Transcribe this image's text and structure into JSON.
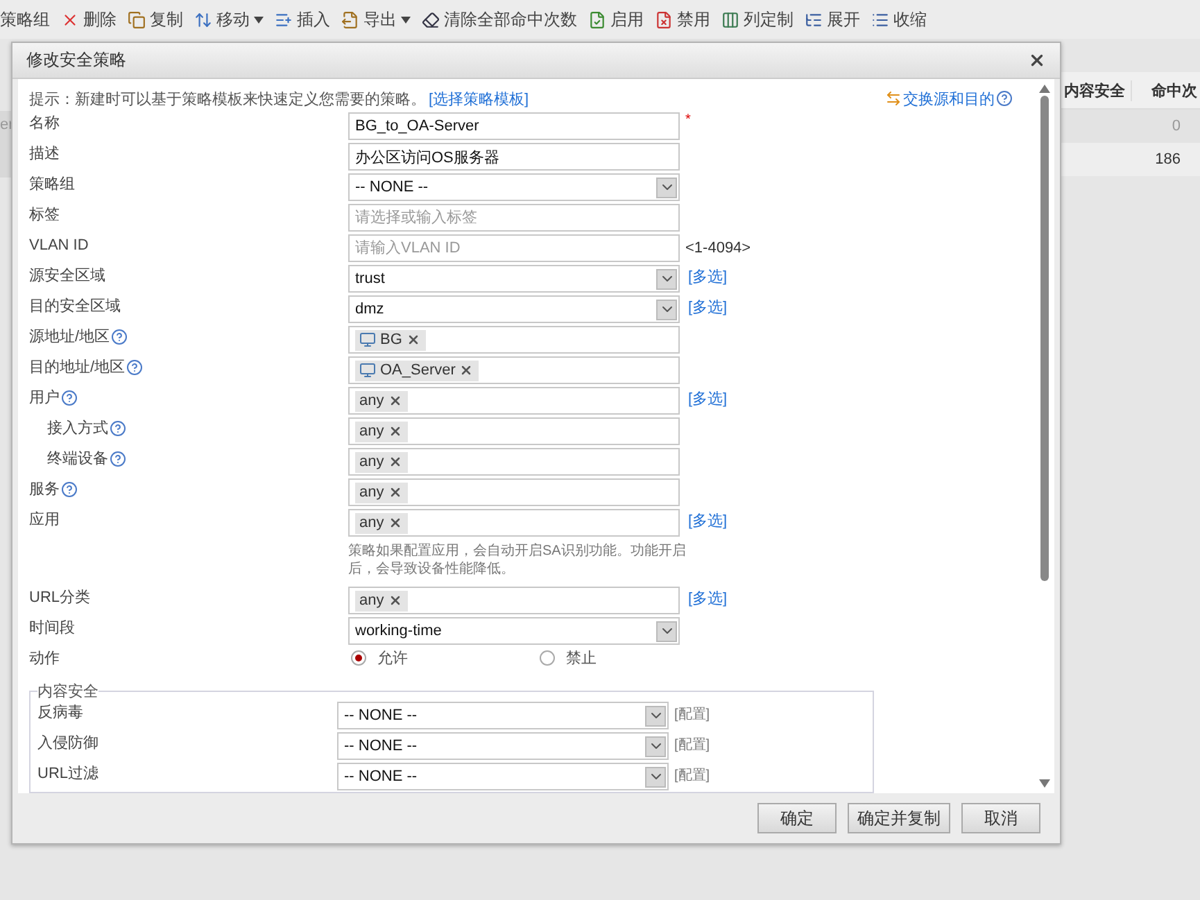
{
  "toolbar": [
    {
      "label": "策略组",
      "kind": "plain",
      "dropdown": false
    },
    {
      "label": "删除",
      "kind": "delete",
      "dropdown": false
    },
    {
      "label": "复制",
      "kind": "copy",
      "dropdown": false
    },
    {
      "label": "移动",
      "kind": "move",
      "dropdown": true
    },
    {
      "label": "插入",
      "kind": "insert",
      "dropdown": false
    },
    {
      "label": "导出",
      "kind": "export",
      "dropdown": true
    },
    {
      "label": "清除全部命中次数",
      "kind": "clear",
      "dropdown": false
    },
    {
      "label": "启用",
      "kind": "enable",
      "dropdown": false
    },
    {
      "label": "禁用",
      "kind": "disable",
      "dropdown": false
    },
    {
      "label": "列定制",
      "kind": "columns",
      "dropdown": false
    },
    {
      "label": "展开",
      "kind": "expand",
      "dropdown": false
    },
    {
      "label": "收缩",
      "kind": "collapse",
      "dropdown": false
    }
  ],
  "background_table": {
    "left_text": "er",
    "columns": [
      "内容安全",
      "命中次"
    ],
    "rows": [
      {
        "hits": "0",
        "disabled": true
      },
      {
        "hits": "186",
        "disabled": false
      }
    ]
  },
  "dialog": {
    "title": "修改安全策略",
    "hint": "提示：新建时可以基于策略模板来快速定义您需要的策略。",
    "hint_link": "[选择策略模板]",
    "swap_link": "交换源和目的",
    "rows": [
      {
        "kind": "text",
        "label": "名称",
        "value": "BG_to_OA-Server",
        "required_mark": "*"
      },
      {
        "kind": "text",
        "label": "描述",
        "value": "办公区访问OS服务器"
      },
      {
        "kind": "select",
        "label": "策略组",
        "value": "-- NONE --"
      },
      {
        "kind": "text",
        "label": "标签",
        "placeholder": "请选择或输入标签"
      },
      {
        "kind": "text",
        "label": "VLAN ID",
        "placeholder": "请输入VLAN ID",
        "extra": "<1-4094>"
      },
      {
        "kind": "select",
        "label": "源安全区域",
        "value": "trust",
        "link": "[多选]"
      },
      {
        "kind": "select",
        "label": "目的安全区域",
        "value": "dmz",
        "link": "[多选]"
      },
      {
        "kind": "tags",
        "label": "源地址/地区",
        "help": true,
        "tags": [
          {
            "text": "BG",
            "kind": "host"
          }
        ]
      },
      {
        "kind": "tags",
        "label": "目的地址/地区",
        "help": true,
        "tags": [
          {
            "text": "OA_Server",
            "kind": "host"
          }
        ]
      },
      {
        "kind": "tags",
        "label": "用户",
        "help": true,
        "tags": [
          {
            "text": "any"
          }
        ],
        "link": "[多选]",
        "children": [
          {
            "kind": "tags",
            "label": "接入方式",
            "help": true,
            "tags": [
              {
                "text": "any"
              }
            ]
          },
          {
            "kind": "tags",
            "label": "终端设备",
            "help": true,
            "tags": [
              {
                "text": "any"
              }
            ]
          }
        ]
      },
      {
        "kind": "tags",
        "label": "服务",
        "help": true,
        "tags": [
          {
            "text": "any"
          }
        ]
      },
      {
        "kind": "tags",
        "label": "应用",
        "tags": [
          {
            "text": "any"
          }
        ],
        "link": "[多选]"
      },
      {
        "kind": "note",
        "text": "策略如果配置应用，会自动开启SA识别功能。功能开启后，会导致设备性能降低。"
      },
      {
        "kind": "tags",
        "label": "URL分类",
        "tags": [
          {
            "text": "any"
          }
        ],
        "link": "[多选]"
      },
      {
        "kind": "select",
        "label": "时间段",
        "value": "working-time"
      },
      {
        "kind": "radio",
        "label": "动作",
        "options": [
          {
            "label": "允许",
            "selected": true
          },
          {
            "label": "禁止",
            "selected": false
          }
        ]
      }
    ],
    "content_security": {
      "legend": "内容安全",
      "rows": [
        {
          "label": "反病毒",
          "value": "-- NONE --",
          "link": "[配置]"
        },
        {
          "label": "入侵防御",
          "value": "-- NONE --",
          "link": "[配置]"
        },
        {
          "label": "URL过滤",
          "value": "-- NONE --",
          "link": "[配置]"
        }
      ]
    },
    "buttons": [
      "确定",
      "确定并复制",
      "取消"
    ]
  }
}
